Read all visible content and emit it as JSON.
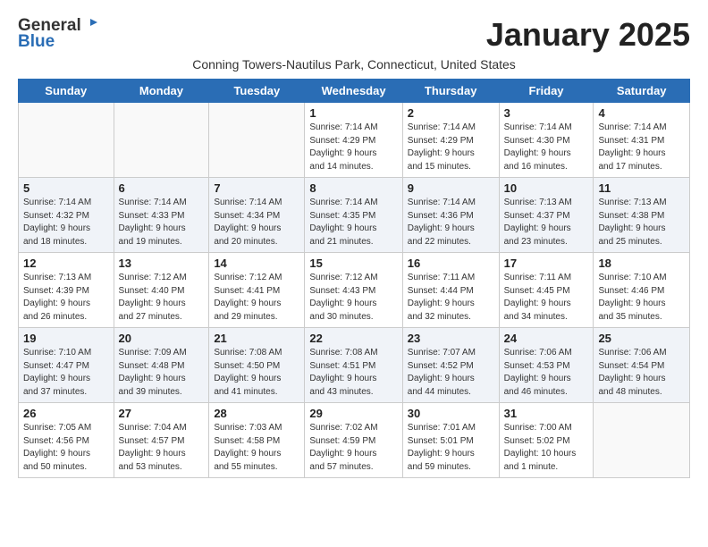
{
  "header": {
    "logo_general": "General",
    "logo_blue": "Blue",
    "month_title": "January 2025",
    "subtitle": "Conning Towers-Nautilus Park, Connecticut, United States"
  },
  "weekdays": [
    "Sunday",
    "Monday",
    "Tuesday",
    "Wednesday",
    "Thursday",
    "Friday",
    "Saturday"
  ],
  "weeks": [
    [
      {
        "day": "",
        "info": ""
      },
      {
        "day": "",
        "info": ""
      },
      {
        "day": "",
        "info": ""
      },
      {
        "day": "1",
        "info": "Sunrise: 7:14 AM\nSunset: 4:29 PM\nDaylight: 9 hours\nand 14 minutes."
      },
      {
        "day": "2",
        "info": "Sunrise: 7:14 AM\nSunset: 4:29 PM\nDaylight: 9 hours\nand 15 minutes."
      },
      {
        "day": "3",
        "info": "Sunrise: 7:14 AM\nSunset: 4:30 PM\nDaylight: 9 hours\nand 16 minutes."
      },
      {
        "day": "4",
        "info": "Sunrise: 7:14 AM\nSunset: 4:31 PM\nDaylight: 9 hours\nand 17 minutes."
      }
    ],
    [
      {
        "day": "5",
        "info": "Sunrise: 7:14 AM\nSunset: 4:32 PM\nDaylight: 9 hours\nand 18 minutes."
      },
      {
        "day": "6",
        "info": "Sunrise: 7:14 AM\nSunset: 4:33 PM\nDaylight: 9 hours\nand 19 minutes."
      },
      {
        "day": "7",
        "info": "Sunrise: 7:14 AM\nSunset: 4:34 PM\nDaylight: 9 hours\nand 20 minutes."
      },
      {
        "day": "8",
        "info": "Sunrise: 7:14 AM\nSunset: 4:35 PM\nDaylight: 9 hours\nand 21 minutes."
      },
      {
        "day": "9",
        "info": "Sunrise: 7:14 AM\nSunset: 4:36 PM\nDaylight: 9 hours\nand 22 minutes."
      },
      {
        "day": "10",
        "info": "Sunrise: 7:13 AM\nSunset: 4:37 PM\nDaylight: 9 hours\nand 23 minutes."
      },
      {
        "day": "11",
        "info": "Sunrise: 7:13 AM\nSunset: 4:38 PM\nDaylight: 9 hours\nand 25 minutes."
      }
    ],
    [
      {
        "day": "12",
        "info": "Sunrise: 7:13 AM\nSunset: 4:39 PM\nDaylight: 9 hours\nand 26 minutes."
      },
      {
        "day": "13",
        "info": "Sunrise: 7:12 AM\nSunset: 4:40 PM\nDaylight: 9 hours\nand 27 minutes."
      },
      {
        "day": "14",
        "info": "Sunrise: 7:12 AM\nSunset: 4:41 PM\nDaylight: 9 hours\nand 29 minutes."
      },
      {
        "day": "15",
        "info": "Sunrise: 7:12 AM\nSunset: 4:43 PM\nDaylight: 9 hours\nand 30 minutes."
      },
      {
        "day": "16",
        "info": "Sunrise: 7:11 AM\nSunset: 4:44 PM\nDaylight: 9 hours\nand 32 minutes."
      },
      {
        "day": "17",
        "info": "Sunrise: 7:11 AM\nSunset: 4:45 PM\nDaylight: 9 hours\nand 34 minutes."
      },
      {
        "day": "18",
        "info": "Sunrise: 7:10 AM\nSunset: 4:46 PM\nDaylight: 9 hours\nand 35 minutes."
      }
    ],
    [
      {
        "day": "19",
        "info": "Sunrise: 7:10 AM\nSunset: 4:47 PM\nDaylight: 9 hours\nand 37 minutes."
      },
      {
        "day": "20",
        "info": "Sunrise: 7:09 AM\nSunset: 4:48 PM\nDaylight: 9 hours\nand 39 minutes."
      },
      {
        "day": "21",
        "info": "Sunrise: 7:08 AM\nSunset: 4:50 PM\nDaylight: 9 hours\nand 41 minutes."
      },
      {
        "day": "22",
        "info": "Sunrise: 7:08 AM\nSunset: 4:51 PM\nDaylight: 9 hours\nand 43 minutes."
      },
      {
        "day": "23",
        "info": "Sunrise: 7:07 AM\nSunset: 4:52 PM\nDaylight: 9 hours\nand 44 minutes."
      },
      {
        "day": "24",
        "info": "Sunrise: 7:06 AM\nSunset: 4:53 PM\nDaylight: 9 hours\nand 46 minutes."
      },
      {
        "day": "25",
        "info": "Sunrise: 7:06 AM\nSunset: 4:54 PM\nDaylight: 9 hours\nand 48 minutes."
      }
    ],
    [
      {
        "day": "26",
        "info": "Sunrise: 7:05 AM\nSunset: 4:56 PM\nDaylight: 9 hours\nand 50 minutes."
      },
      {
        "day": "27",
        "info": "Sunrise: 7:04 AM\nSunset: 4:57 PM\nDaylight: 9 hours\nand 53 minutes."
      },
      {
        "day": "28",
        "info": "Sunrise: 7:03 AM\nSunset: 4:58 PM\nDaylight: 9 hours\nand 55 minutes."
      },
      {
        "day": "29",
        "info": "Sunrise: 7:02 AM\nSunset: 4:59 PM\nDaylight: 9 hours\nand 57 minutes."
      },
      {
        "day": "30",
        "info": "Sunrise: 7:01 AM\nSunset: 5:01 PM\nDaylight: 9 hours\nand 59 minutes."
      },
      {
        "day": "31",
        "info": "Sunrise: 7:00 AM\nSunset: 5:02 PM\nDaylight: 10 hours\nand 1 minute."
      },
      {
        "day": "",
        "info": ""
      }
    ]
  ]
}
